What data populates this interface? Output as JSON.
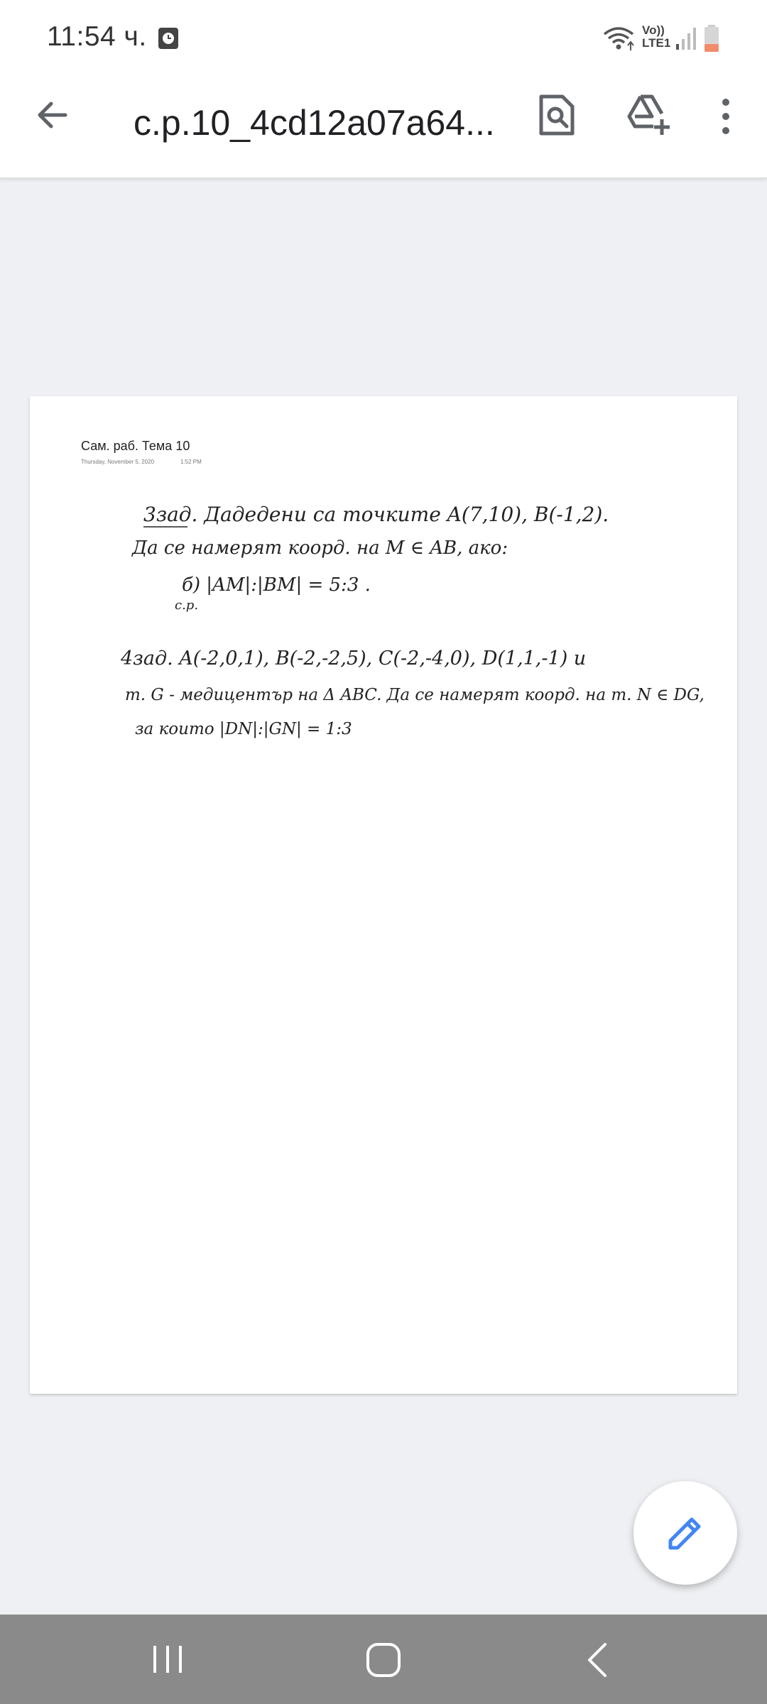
{
  "status_bar": {
    "time": "11:54 ч.",
    "network_label_top": "Vo))",
    "network_label_bottom": "LTE1",
    "icons": [
      "alarm-icon",
      "wifi-icon",
      "signal-icon",
      "battery-icon"
    ]
  },
  "app_bar": {
    "title": "c.p.10_4cd12a07a64...",
    "icons": [
      "back-arrow-icon",
      "search-document-icon",
      "add-to-drive-icon",
      "more-vert-icon"
    ]
  },
  "document": {
    "note_title": "Сам. раб. Тема 10",
    "note_date": "Thursday, November 5, 2020",
    "note_time": "1:52 PM",
    "handwritten_lines": [
      "3зад. Дадедени са точките A(7,10), B(-1,2).",
      "Да се намерят коорд. на M ∈ AB, ако:",
      "б) |AM|:|BM| = 5:3 .",
      "с.р.",
      "4зад.   A(-2,0,1), B(-2,-2,5), C(-2,-4,0), D(1,1,-1) и",
      "т. G - медицентър на Δ ABC.   Да се намерят коорд. на т. N ∈ DG,",
      "за които  |DN|:|GN| = 1:3"
    ]
  },
  "fab": {
    "icon": "edit-pencil-icon"
  },
  "nav_bar": {
    "icons": [
      "recents-icon",
      "home-icon",
      "back-icon"
    ]
  },
  "colors": {
    "accent": "#4285f4",
    "background": "#eef0f3",
    "navbar": "#8a8a8a"
  }
}
